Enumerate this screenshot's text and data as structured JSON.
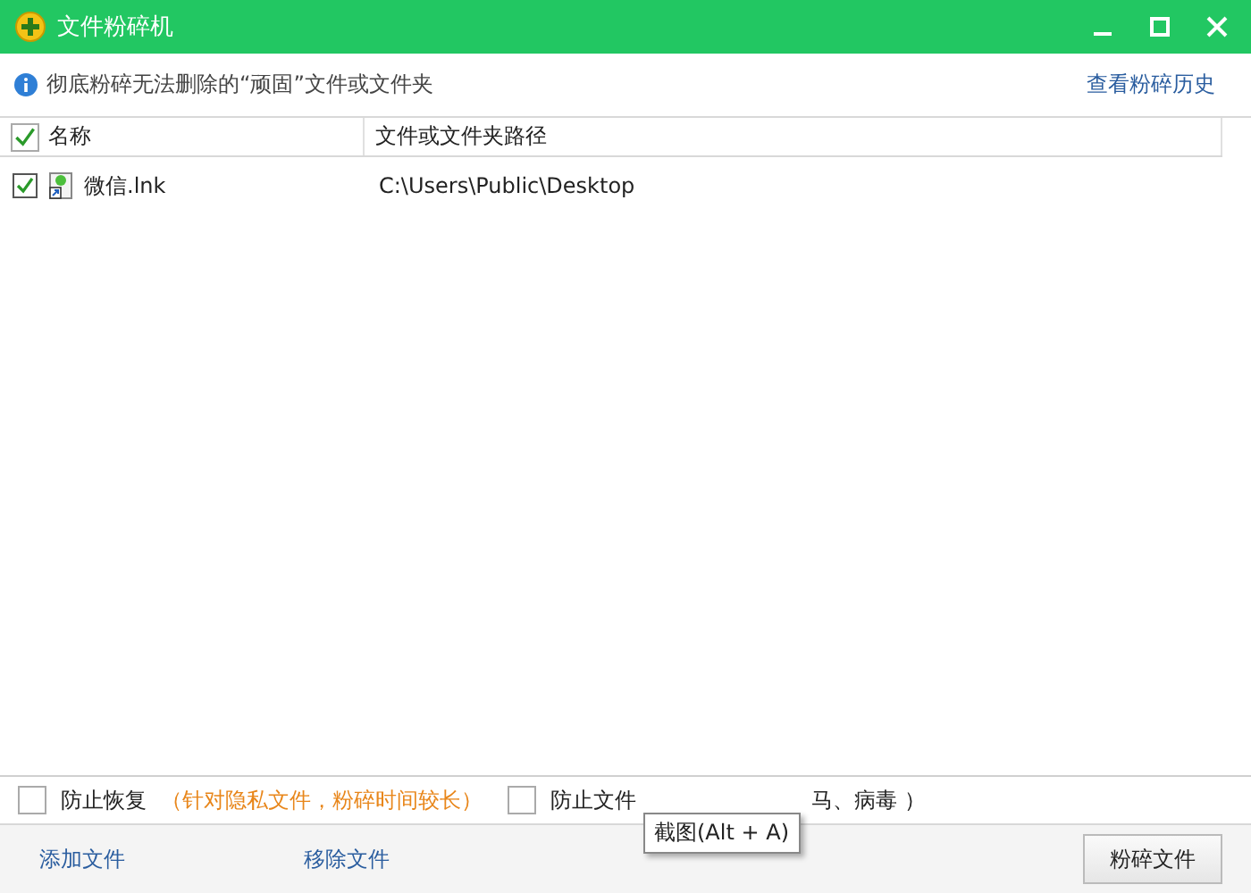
{
  "window": {
    "title": "文件粉碎机"
  },
  "info": {
    "text": "彻底粉碎无法删除的“顽固”文件或文件夹",
    "link": "查看粉碎历史"
  },
  "table": {
    "select_all_checked": true,
    "columns": [
      "名称",
      "文件或文件夹路径"
    ],
    "rows": [
      {
        "checked": true,
        "name": "微信.lnk",
        "path": "C:\\Users\\Public\\Desktop"
      }
    ]
  },
  "options": [
    {
      "checked": false,
      "label": "防止恢复",
      "note": "（针对隐私文件，粉碎时间较长）"
    },
    {
      "checked": false,
      "label": "防止文件",
      "note": "马、病毒 ）"
    }
  ],
  "tooltip": "截图(Alt + A)",
  "actions": {
    "add": "添加文件",
    "remove": "移除文件",
    "shred": "粉碎文件"
  }
}
